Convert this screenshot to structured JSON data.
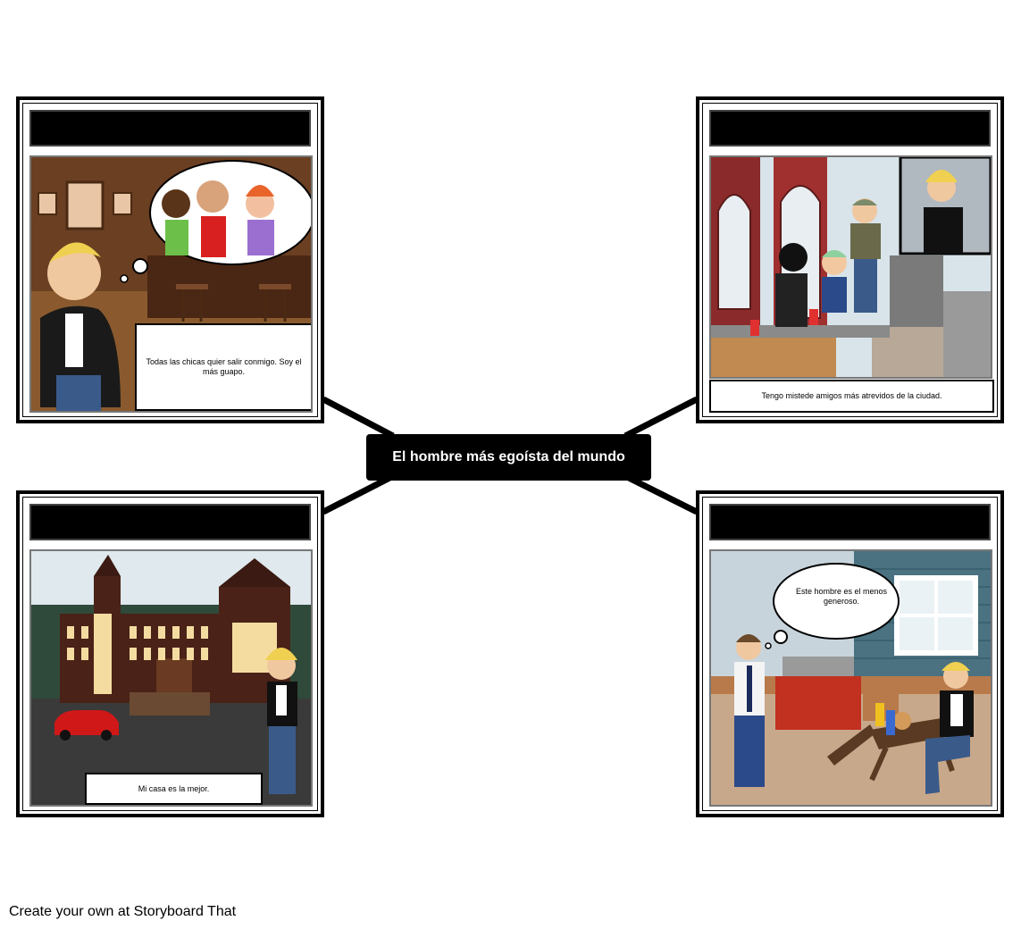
{
  "center_title": "El hombre más egoísta del mundo",
  "panels": [
    {
      "position": "top-left",
      "caption": "Todas las chicas quier salir conmigo. Soy el más guapo.",
      "scene": "bar-interior-thinking-of-girls"
    },
    {
      "position": "top-right",
      "caption": "Tengo mistede amigos más atrevidos de la ciudad.",
      "scene": "rooftop-friends-city"
    },
    {
      "position": "bottom-left",
      "caption": "Mi casa es la mejor.",
      "scene": "mansion-with-red-car"
    },
    {
      "position": "bottom-right",
      "caption": "",
      "thought_bubble": "Este hombre es el menos generoso.",
      "scene": "backyard-bbq"
    }
  ],
  "footer": "Create your own at Storyboard That",
  "colors": {
    "frame": "#000000",
    "background": "#ffffff",
    "center_text": "#ffffff"
  }
}
